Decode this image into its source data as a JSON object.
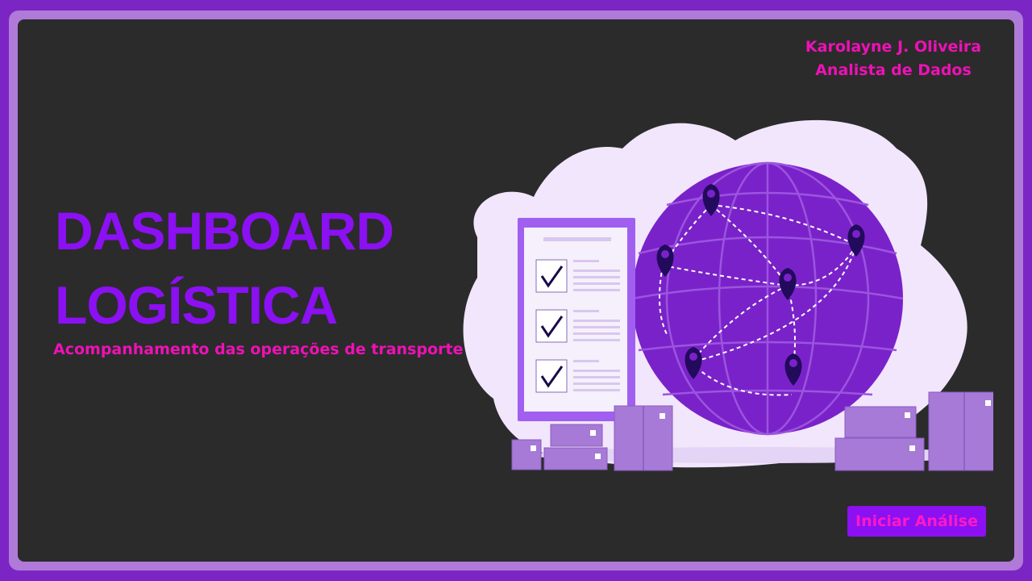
{
  "author": {
    "name": "Karolayne J. Oliveira",
    "role": "Analista de Dados"
  },
  "hero": {
    "title_line1": "DASHBOARD",
    "title_line2": "LOGÍSTICA",
    "subtitle": "Acompanhamento das operações de transporte"
  },
  "actions": {
    "start_label": "Iniciar Análise"
  },
  "colors": {
    "frame": "#7b25c4",
    "panel": "#2b2b2b",
    "title": "#8b10f2",
    "accent": "#ee11b6",
    "globe": "#7a22c9",
    "blob": "#f1e6fb",
    "boxes": "#a67ad6"
  },
  "illustration": {
    "icons": [
      "globe-icon",
      "checklist-icon",
      "map-pin-icon",
      "package-box-icon"
    ]
  }
}
